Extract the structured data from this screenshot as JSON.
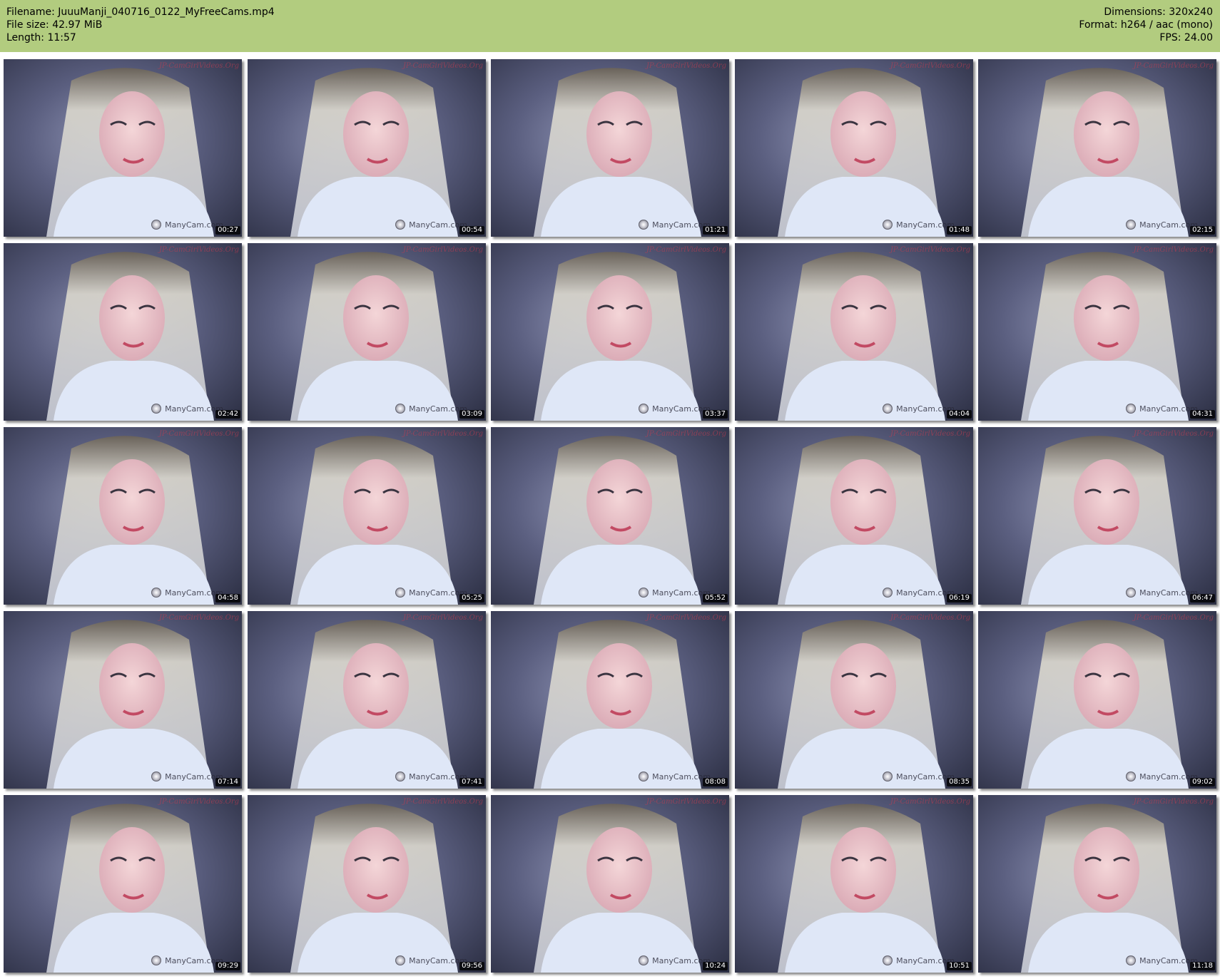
{
  "header": {
    "filename_line": "Filename: JuuuManji_040716_0122_MyFreeCams.mp4",
    "filesize_line": "File size: 42.97 MiB",
    "length_line": "Length: 11:57",
    "dimensions_line": "Dimensions: 320x240",
    "format_line": "Format: h264 / aac (mono)",
    "fps_line": "FPS: 24.00",
    "background_color": "#b2cc7f"
  },
  "watermarks": {
    "top": "JP-CamGirlVideos.Org",
    "bottom": "ManyCam.com"
  },
  "thumbnails": [
    "00:27",
    "00:54",
    "01:21",
    "01:48",
    "02:15",
    "02:42",
    "03:09",
    "03:37",
    "04:04",
    "04:31",
    "04:58",
    "05:25",
    "05:52",
    "06:19",
    "06:47",
    "07:14",
    "07:41",
    "08:08",
    "08:35",
    "09:02",
    "09:29",
    "09:56",
    "10:24",
    "10:51",
    "11:18"
  ]
}
